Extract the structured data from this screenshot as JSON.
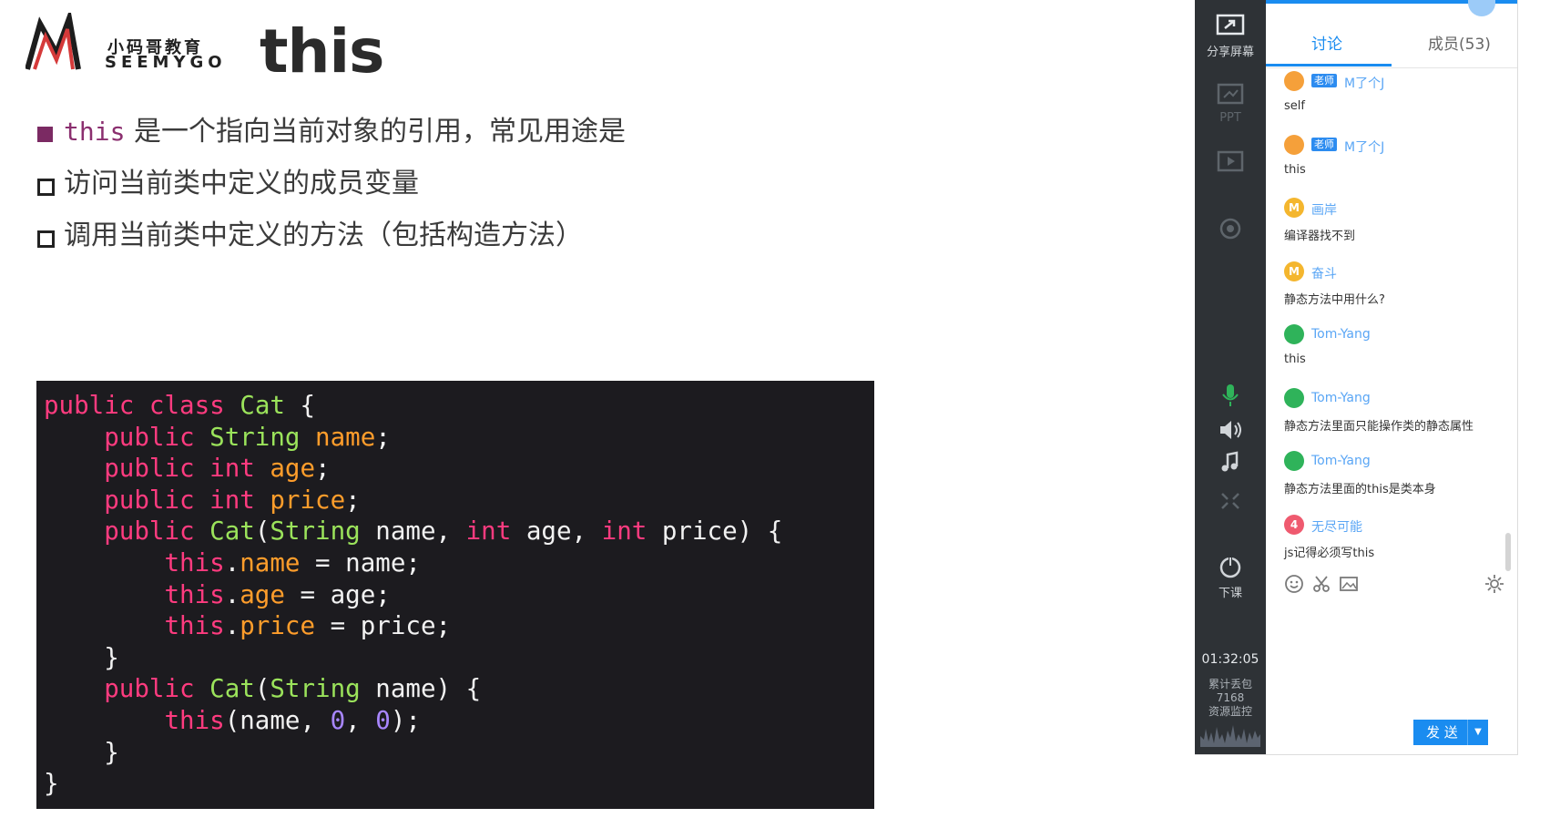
{
  "logo": {
    "mark": "M",
    "cn": "小码哥教育",
    "en": "SEEMYGO"
  },
  "slide": {
    "title": "this",
    "bullets": [
      {
        "style": "filled",
        "keyword": "this",
        "text": " 是一个指向当前对象的引用，常见用途是"
      },
      {
        "style": "hollow",
        "keyword": "",
        "text": "访问当前类中定义的成员变量"
      },
      {
        "style": "hollow",
        "keyword": "",
        "text": "调用当前类中定义的方法（包括构造方法）"
      }
    ],
    "code": {
      "lines": [
        [
          [
            "kw",
            "public"
          ],
          [
            "plain",
            " "
          ],
          [
            "kw",
            "class"
          ],
          [
            "plain",
            " "
          ],
          [
            "type",
            "Cat"
          ],
          [
            "plain",
            " {"
          ]
        ],
        [
          [
            "plain",
            "    "
          ],
          [
            "kw",
            "public"
          ],
          [
            "plain",
            " "
          ],
          [
            "type",
            "String"
          ],
          [
            "plain",
            " "
          ],
          [
            "field",
            "name"
          ],
          [
            "plain",
            ";"
          ]
        ],
        [
          [
            "plain",
            "    "
          ],
          [
            "kw",
            "public"
          ],
          [
            "plain",
            " "
          ],
          [
            "kw",
            "int"
          ],
          [
            "plain",
            " "
          ],
          [
            "field",
            "age"
          ],
          [
            "plain",
            ";"
          ]
        ],
        [
          [
            "plain",
            "    "
          ],
          [
            "kw",
            "public"
          ],
          [
            "plain",
            " "
          ],
          [
            "kw",
            "int"
          ],
          [
            "plain",
            " "
          ],
          [
            "field",
            "price"
          ],
          [
            "plain",
            ";"
          ]
        ],
        [
          [
            "plain",
            "    "
          ],
          [
            "kw",
            "public"
          ],
          [
            "plain",
            " "
          ],
          [
            "type",
            "Cat"
          ],
          [
            "plain",
            "("
          ],
          [
            "type",
            "String"
          ],
          [
            "plain",
            " name, "
          ],
          [
            "kw",
            "int"
          ],
          [
            "plain",
            " age, "
          ],
          [
            "kw",
            "int"
          ],
          [
            "plain",
            " price) {"
          ]
        ],
        [
          [
            "plain",
            "        "
          ],
          [
            "kw",
            "this"
          ],
          [
            "plain",
            "."
          ],
          [
            "field",
            "name"
          ],
          [
            "plain",
            " = name;"
          ]
        ],
        [
          [
            "plain",
            "        "
          ],
          [
            "kw",
            "this"
          ],
          [
            "plain",
            "."
          ],
          [
            "field",
            "age"
          ],
          [
            "plain",
            " = age;"
          ]
        ],
        [
          [
            "plain",
            "        "
          ],
          [
            "kw",
            "this"
          ],
          [
            "plain",
            "."
          ],
          [
            "field",
            "price"
          ],
          [
            "plain",
            " = price;"
          ]
        ],
        [
          [
            "plain",
            "    }"
          ]
        ],
        [
          [
            "plain",
            "    "
          ],
          [
            "kw",
            "public"
          ],
          [
            "plain",
            " "
          ],
          [
            "type",
            "Cat"
          ],
          [
            "plain",
            "("
          ],
          [
            "type",
            "String"
          ],
          [
            "plain",
            " name) {"
          ]
        ],
        [
          [
            "plain",
            "        "
          ],
          [
            "kw",
            "this"
          ],
          [
            "plain",
            "(name, "
          ],
          [
            "num",
            "0"
          ],
          [
            "plain",
            ", "
          ],
          [
            "num",
            "0"
          ],
          [
            "plain",
            ");"
          ]
        ],
        [
          [
            "plain",
            "    }"
          ]
        ],
        [
          [
            "plain",
            "}"
          ]
        ]
      ]
    }
  },
  "panel": {
    "rail": {
      "share_label": "分享屏幕",
      "ppt_label": "PPT",
      "end_label": "下课",
      "timer": "01:32:05",
      "stat_label": "累计丢包",
      "stat_value": "7168",
      "monitor_label": "资源监控"
    },
    "tabs": {
      "discussion": "讨论",
      "members": "成员(53)"
    },
    "messages": [
      {
        "avatar": "orange",
        "tag": "老师",
        "name": "M了个J",
        "text": "self"
      },
      {
        "avatar": "orange",
        "tag": "老师",
        "name": "M了个J",
        "text": "this"
      },
      {
        "avatar": "yellow",
        "avatar_char": "M",
        "tag": "",
        "name": "画岸",
        "text": "编译器找不到"
      },
      {
        "avatar": "yellow",
        "avatar_char": "M",
        "tag": "",
        "name": "奋斗",
        "text": "静态方法中用什么?"
      },
      {
        "avatar": "green",
        "tag": "",
        "name": "Tom-Yang",
        "text": "this"
      },
      {
        "avatar": "green",
        "tag": "",
        "name": "Tom-Yang",
        "text": "静态方法里面只能操作类的静态属性"
      },
      {
        "avatar": "green",
        "tag": "",
        "name": "Tom-Yang",
        "text": "静态方法里面的this是类本身"
      },
      {
        "avatar": "red",
        "avatar_char": "4",
        "tag": "",
        "name": "无尽可能",
        "text": "js记得必须写this"
      }
    ],
    "send_label": "发 送",
    "colors": {
      "accent": "#1a8cf0",
      "rail": "#2e3236",
      "code_bg": "#1c1b1f"
    }
  }
}
